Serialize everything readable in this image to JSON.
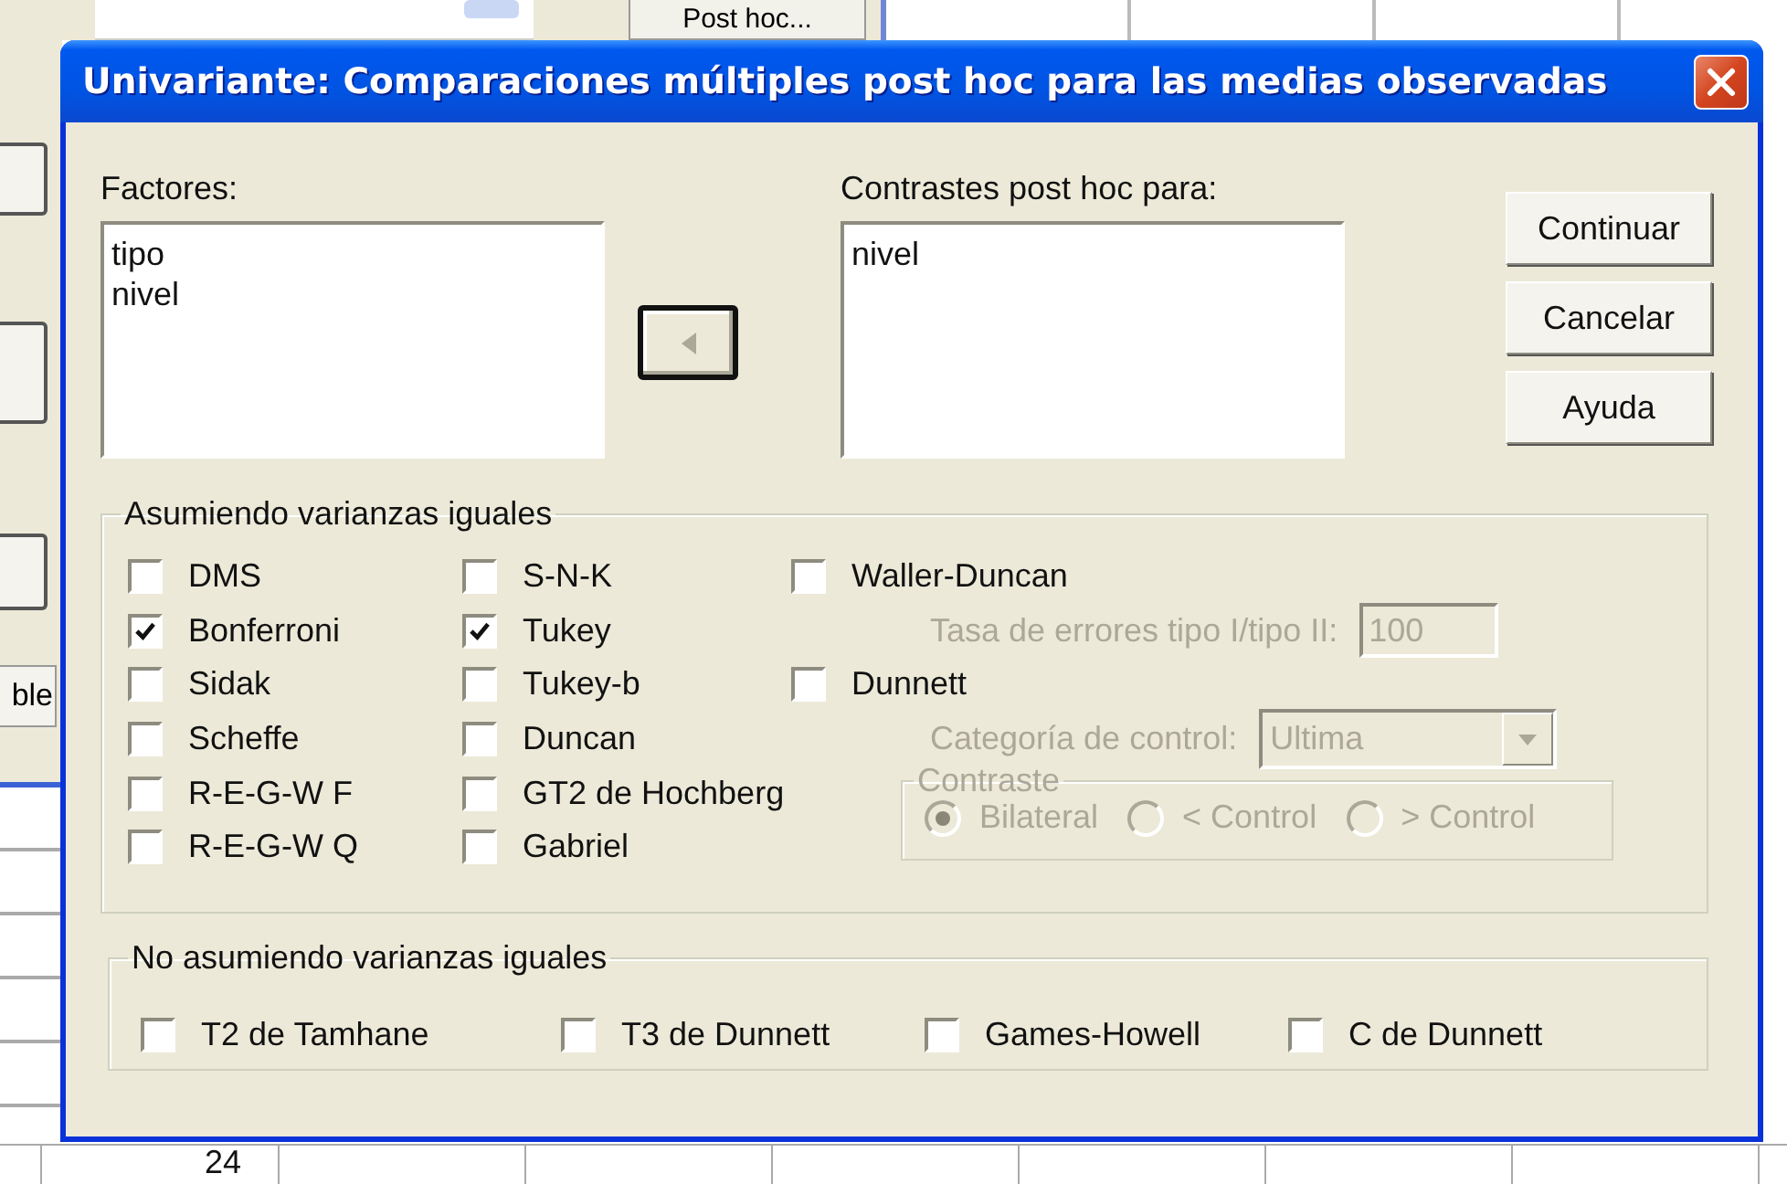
{
  "background": {
    "field_button_label": "Post hoc...",
    "side_button_label": "ble",
    "cell_value": "24"
  },
  "window": {
    "title": "Univariante: Comparaciones múltiples post hoc para las medias observadas"
  },
  "factors": {
    "label": "Factores:",
    "items": [
      {
        "text": "tipo"
      },
      {
        "text": "nivel"
      }
    ]
  },
  "post_hoc_for": {
    "label": "Contrastes post hoc para:",
    "items": [
      {
        "text": "nivel"
      }
    ]
  },
  "buttons": [
    "Continuar",
    "Cancelar",
    "Ayuda"
  ],
  "equal_variances": {
    "title": "Asumiendo varianzas iguales",
    "columns": [
      [
        {
          "label": "DMS",
          "checked": false
        },
        {
          "label": "Bonferroni",
          "checked": true
        },
        {
          "label": "Sidak",
          "checked": false
        },
        {
          "label": "Scheffe",
          "checked": false
        },
        {
          "label": "R-E-G-W F",
          "checked": false
        },
        {
          "label": "R-E-G-W Q",
          "checked": false
        }
      ],
      [
        {
          "label": "S-N-K",
          "checked": false
        },
        {
          "label": "Tukey",
          "checked": true
        },
        {
          "label": "Tukey-b",
          "checked": false
        },
        {
          "label": "Duncan",
          "checked": false
        },
        {
          "label": "GT2 de Hochberg",
          "checked": false
        },
        {
          "label": "Gabriel",
          "checked": false
        }
      ]
    ],
    "waller_duncan": {
      "label": "Waller-Duncan",
      "checked": false,
      "rate_label": "Tasa de errores tipo I/tipo II:",
      "rate_value": "100",
      "disabled": true
    },
    "dunnett": {
      "label": "Dunnett",
      "checked": false,
      "control_label": "Categoría de control:",
      "control_value": "Ultima",
      "disabled": true,
      "contrast": {
        "title": "Contraste",
        "options": [
          {
            "label": "Bilateral",
            "selected": true
          },
          {
            "label": "< Control",
            "selected": false
          },
          {
            "label": "> Control",
            "selected": false
          }
        ]
      }
    }
  },
  "unequal_variances": {
    "title": "No asumiendo varianzas iguales",
    "options": [
      {
        "label": "T2 de Tamhane",
        "checked": false
      },
      {
        "label": "T3 de Dunnett",
        "checked": false
      },
      {
        "label": "Games-Howell",
        "checked": false
      },
      {
        "label": "C de Dunnett",
        "checked": false
      }
    ]
  }
}
